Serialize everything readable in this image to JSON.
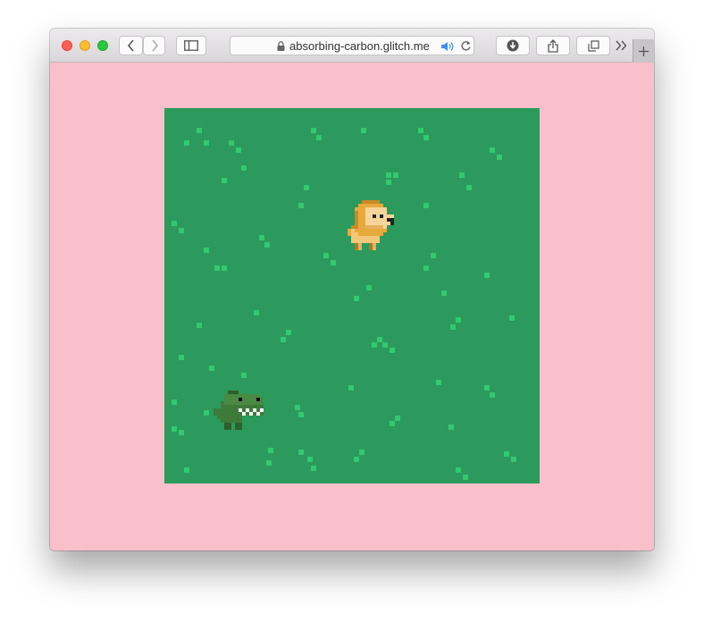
{
  "browser": {
    "url": "absorbing-carbon.glitch.me",
    "traffic_lights": [
      "close",
      "minimize",
      "zoom"
    ],
    "toolbar_icons": [
      "back-icon",
      "forward-icon",
      "sidebar-icon",
      "lock-icon",
      "audio-icon",
      "reload-icon",
      "download-icon",
      "share-icon",
      "tabs-overview-icon",
      "overflow-icon",
      "new-tab-icon"
    ]
  },
  "page": {
    "background": "#f9bfca",
    "game_field_color": "#2b9a5c",
    "grass_color": "#34c872",
    "sprites": [
      "lion",
      "crocodile"
    ]
  }
}
